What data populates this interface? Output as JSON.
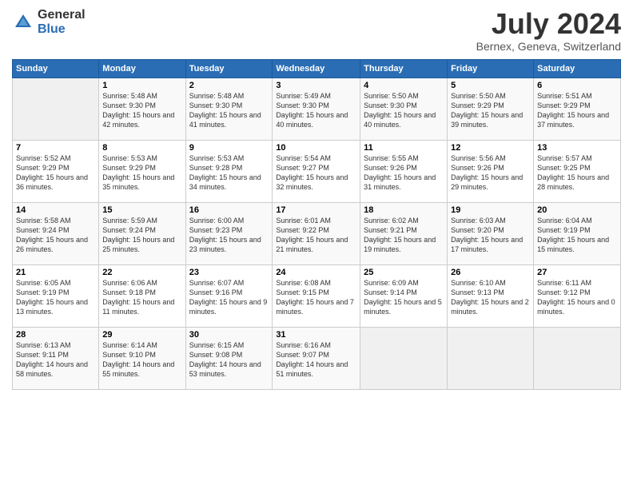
{
  "logo": {
    "general": "General",
    "blue": "Blue"
  },
  "header": {
    "month": "July 2024",
    "location": "Bernex, Geneva, Switzerland"
  },
  "weekdays": [
    "Sunday",
    "Monday",
    "Tuesday",
    "Wednesday",
    "Thursday",
    "Friday",
    "Saturday"
  ],
  "weeks": [
    [
      {
        "day": "",
        "sunrise": "",
        "sunset": "",
        "daylight": ""
      },
      {
        "day": "1",
        "sunrise": "Sunrise: 5:48 AM",
        "sunset": "Sunset: 9:30 PM",
        "daylight": "Daylight: 15 hours and 42 minutes."
      },
      {
        "day": "2",
        "sunrise": "Sunrise: 5:48 AM",
        "sunset": "Sunset: 9:30 PM",
        "daylight": "Daylight: 15 hours and 41 minutes."
      },
      {
        "day": "3",
        "sunrise": "Sunrise: 5:49 AM",
        "sunset": "Sunset: 9:30 PM",
        "daylight": "Daylight: 15 hours and 40 minutes."
      },
      {
        "day": "4",
        "sunrise": "Sunrise: 5:50 AM",
        "sunset": "Sunset: 9:30 PM",
        "daylight": "Daylight: 15 hours and 40 minutes."
      },
      {
        "day": "5",
        "sunrise": "Sunrise: 5:50 AM",
        "sunset": "Sunset: 9:29 PM",
        "daylight": "Daylight: 15 hours and 39 minutes."
      },
      {
        "day": "6",
        "sunrise": "Sunrise: 5:51 AM",
        "sunset": "Sunset: 9:29 PM",
        "daylight": "Daylight: 15 hours and 37 minutes."
      }
    ],
    [
      {
        "day": "7",
        "sunrise": "Sunrise: 5:52 AM",
        "sunset": "Sunset: 9:29 PM",
        "daylight": "Daylight: 15 hours and 36 minutes."
      },
      {
        "day": "8",
        "sunrise": "Sunrise: 5:53 AM",
        "sunset": "Sunset: 9:29 PM",
        "daylight": "Daylight: 15 hours and 35 minutes."
      },
      {
        "day": "9",
        "sunrise": "Sunrise: 5:53 AM",
        "sunset": "Sunset: 9:28 PM",
        "daylight": "Daylight: 15 hours and 34 minutes."
      },
      {
        "day": "10",
        "sunrise": "Sunrise: 5:54 AM",
        "sunset": "Sunset: 9:27 PM",
        "daylight": "Daylight: 15 hours and 32 minutes."
      },
      {
        "day": "11",
        "sunrise": "Sunrise: 5:55 AM",
        "sunset": "Sunset: 9:26 PM",
        "daylight": "Daylight: 15 hours and 31 minutes."
      },
      {
        "day": "12",
        "sunrise": "Sunrise: 5:56 AM",
        "sunset": "Sunset: 9:26 PM",
        "daylight": "Daylight: 15 hours and 29 minutes."
      },
      {
        "day": "13",
        "sunrise": "Sunrise: 5:57 AM",
        "sunset": "Sunset: 9:25 PM",
        "daylight": "Daylight: 15 hours and 28 minutes."
      }
    ],
    [
      {
        "day": "14",
        "sunrise": "Sunrise: 5:58 AM",
        "sunset": "Sunset: 9:24 PM",
        "daylight": "Daylight: 15 hours and 26 minutes."
      },
      {
        "day": "15",
        "sunrise": "Sunrise: 5:59 AM",
        "sunset": "Sunset: 9:24 PM",
        "daylight": "Daylight: 15 hours and 25 minutes."
      },
      {
        "day": "16",
        "sunrise": "Sunrise: 6:00 AM",
        "sunset": "Sunset: 9:23 PM",
        "daylight": "Daylight: 15 hours and 23 minutes."
      },
      {
        "day": "17",
        "sunrise": "Sunrise: 6:01 AM",
        "sunset": "Sunset: 9:22 PM",
        "daylight": "Daylight: 15 hours and 21 minutes."
      },
      {
        "day": "18",
        "sunrise": "Sunrise: 6:02 AM",
        "sunset": "Sunset: 9:21 PM",
        "daylight": "Daylight: 15 hours and 19 minutes."
      },
      {
        "day": "19",
        "sunrise": "Sunrise: 6:03 AM",
        "sunset": "Sunset: 9:20 PM",
        "daylight": "Daylight: 15 hours and 17 minutes."
      },
      {
        "day": "20",
        "sunrise": "Sunrise: 6:04 AM",
        "sunset": "Sunset: 9:19 PM",
        "daylight": "Daylight: 15 hours and 15 minutes."
      }
    ],
    [
      {
        "day": "21",
        "sunrise": "Sunrise: 6:05 AM",
        "sunset": "Sunset: 9:19 PM",
        "daylight": "Daylight: 15 hours and 13 minutes."
      },
      {
        "day": "22",
        "sunrise": "Sunrise: 6:06 AM",
        "sunset": "Sunset: 9:18 PM",
        "daylight": "Daylight: 15 hours and 11 minutes."
      },
      {
        "day": "23",
        "sunrise": "Sunrise: 6:07 AM",
        "sunset": "Sunset: 9:16 PM",
        "daylight": "Daylight: 15 hours and 9 minutes."
      },
      {
        "day": "24",
        "sunrise": "Sunrise: 6:08 AM",
        "sunset": "Sunset: 9:15 PM",
        "daylight": "Daylight: 15 hours and 7 minutes."
      },
      {
        "day": "25",
        "sunrise": "Sunrise: 6:09 AM",
        "sunset": "Sunset: 9:14 PM",
        "daylight": "Daylight: 15 hours and 5 minutes."
      },
      {
        "day": "26",
        "sunrise": "Sunrise: 6:10 AM",
        "sunset": "Sunset: 9:13 PM",
        "daylight": "Daylight: 15 hours and 2 minutes."
      },
      {
        "day": "27",
        "sunrise": "Sunrise: 6:11 AM",
        "sunset": "Sunset: 9:12 PM",
        "daylight": "Daylight: 15 hours and 0 minutes."
      }
    ],
    [
      {
        "day": "28",
        "sunrise": "Sunrise: 6:13 AM",
        "sunset": "Sunset: 9:11 PM",
        "daylight": "Daylight: 14 hours and 58 minutes."
      },
      {
        "day": "29",
        "sunrise": "Sunrise: 6:14 AM",
        "sunset": "Sunset: 9:10 PM",
        "daylight": "Daylight: 14 hours and 55 minutes."
      },
      {
        "day": "30",
        "sunrise": "Sunrise: 6:15 AM",
        "sunset": "Sunset: 9:08 PM",
        "daylight": "Daylight: 14 hours and 53 minutes."
      },
      {
        "day": "31",
        "sunrise": "Sunrise: 6:16 AM",
        "sunset": "Sunset: 9:07 PM",
        "daylight": "Daylight: 14 hours and 51 minutes."
      },
      {
        "day": "",
        "sunrise": "",
        "sunset": "",
        "daylight": ""
      },
      {
        "day": "",
        "sunrise": "",
        "sunset": "",
        "daylight": ""
      },
      {
        "day": "",
        "sunrise": "",
        "sunset": "",
        "daylight": ""
      }
    ]
  ]
}
